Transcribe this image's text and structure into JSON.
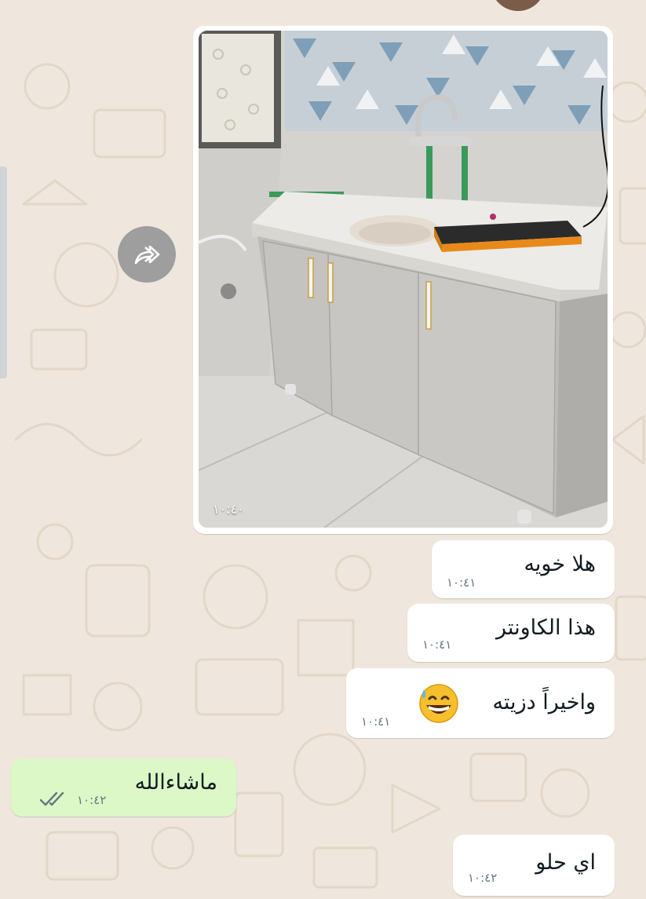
{
  "chat": {
    "messages": [
      {
        "id": "m0",
        "direction": "incoming",
        "type": "image",
        "time": "١٠:٤٠"
      },
      {
        "id": "m1",
        "direction": "incoming",
        "text": "هلا خويه",
        "time": "١٠:٤١"
      },
      {
        "id": "m2",
        "direction": "incoming",
        "text": "هذا الكاونتر",
        "time": "١٠:٤١"
      },
      {
        "id": "m3",
        "direction": "incoming",
        "text": "واخيراً دزيته",
        "emoji": "grinning-face-with-sweat-emoji",
        "time": "١٠:٤١"
      },
      {
        "id": "m4",
        "direction": "outgoing",
        "text": "ماشاءالله",
        "time": "١٠:٤٢",
        "status": "read"
      },
      {
        "id": "m5",
        "direction": "incoming",
        "text": "اي حلو",
        "time": "١٠:٤٢"
      }
    ]
  },
  "icons": {
    "forward": "forward-icon",
    "read_receipt": "double-check-icon",
    "emoji": "grinning-face-with-sweat-emoji"
  },
  "colors": {
    "wallpaper": "#efe7dd",
    "incoming_bubble": "#ffffff",
    "outgoing_bubble": "#dcf8c6",
    "read_ticks": "#667781",
    "timestamp": "#667781"
  }
}
